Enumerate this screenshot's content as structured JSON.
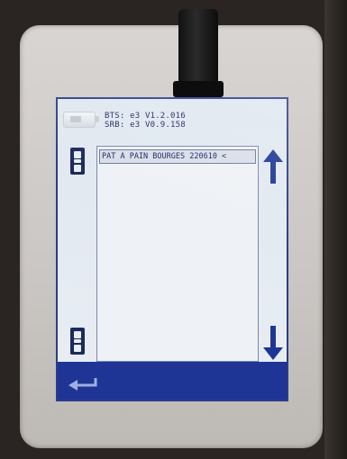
{
  "device": {
    "firmware": {
      "bts": "BTS: e3 V1.2.016",
      "srb": "SRB: e3 V0.9.158"
    }
  },
  "list": {
    "items": [
      {
        "label": "PAT A PAIN BOURGES 220610 <"
      }
    ]
  },
  "icons": {
    "usb": "usb-drive-icon",
    "scroll_top": "scroll-to-top-icon",
    "scroll_bottom": "scroll-to-bottom-icon",
    "up": "arrow-up-icon",
    "down": "arrow-down-icon",
    "back": "back-arrow-icon"
  },
  "colors": {
    "accent": "#1f3596",
    "text": "#1b2260",
    "screen_bg": "#e4ebf2"
  }
}
